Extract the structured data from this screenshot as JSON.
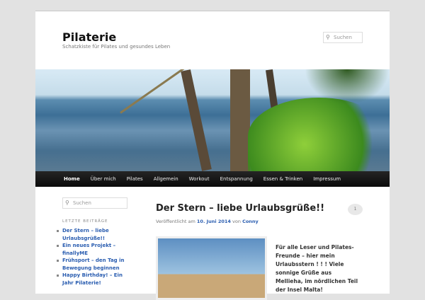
{
  "site": {
    "title": "Pilaterie",
    "tagline": "Schatzkiste für Pilates und gesundes Leben"
  },
  "search": {
    "placeholder": "Suchen"
  },
  "nav": [
    "Home",
    "Über mich",
    "Pilates",
    "Allgemein",
    "Workout",
    "Entspannung",
    "Essen & Trinken",
    "Impressum"
  ],
  "sidebar": {
    "search_placeholder": "Suchen",
    "heading": "LETZTE BEITRÄGE",
    "items": [
      "Der Stern – liebe Urlaubsgrüße!!",
      "Ein neues Projekt – finallyME",
      "Frühsport – den Tag in Bewegung beginnen",
      "Happy Birthday! – Ein Jahr Pilaterie!"
    ]
  },
  "post": {
    "title": "Der Stern – liebe Urlaubsgrüße!!",
    "comments": "1",
    "meta_prefix": "Veröffentlicht am",
    "date": "10. Juni 2014",
    "meta_by": "von",
    "author": "Conny",
    "text": "Für alle Leser und Pilates-Freunde – hier mein Urlaubsstern ! ! ! Viele sonnige Grüße aus Mellieha, im nördlichen Teil der Insel Malta!"
  }
}
